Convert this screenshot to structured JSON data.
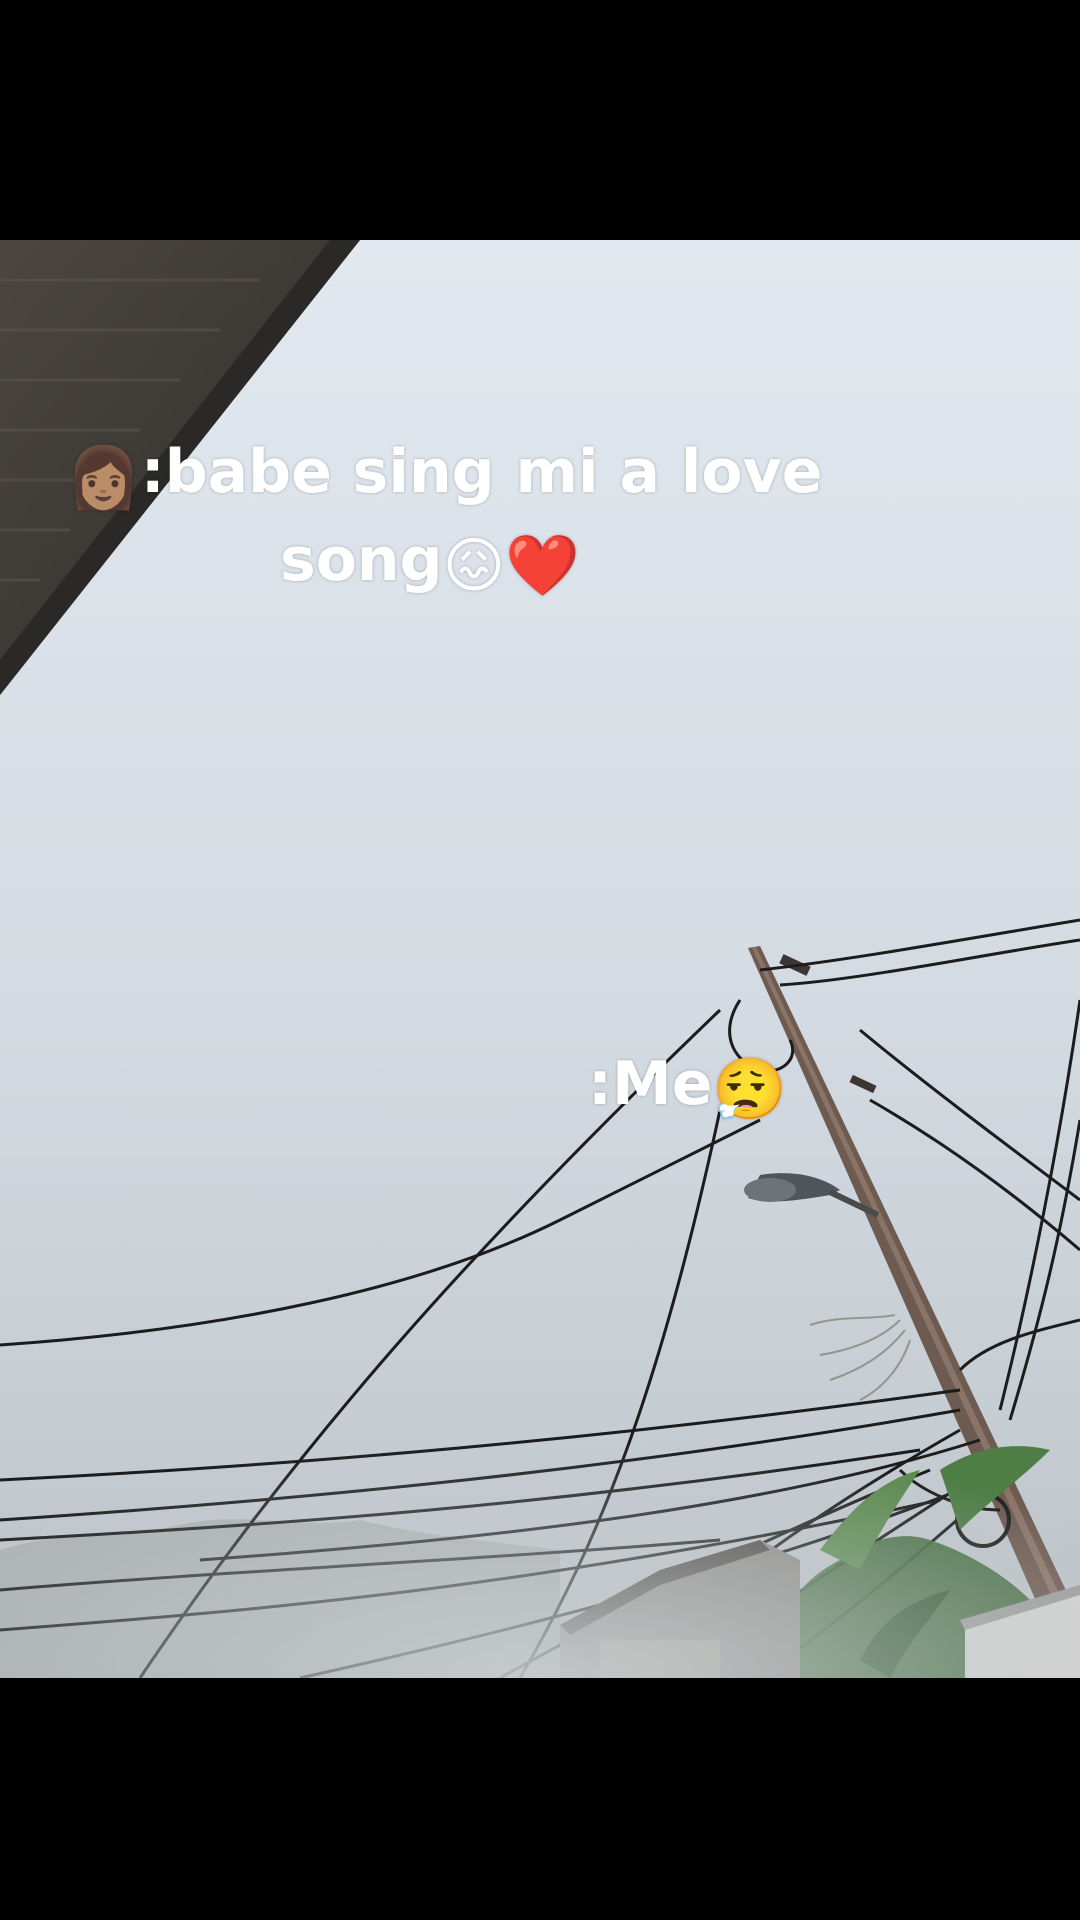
{
  "captions": {
    "line1_prefix_emoji": "👩🏽",
    "line1_text": ":babe sing mi a love",
    "line2_text": "song",
    "line2_emoji_1": "😖",
    "line2_emoji_2": "❤️",
    "me_text": ":Me",
    "me_emoji": "😮‍💨"
  },
  "colors": {
    "caption": "#ffffff",
    "sky_top": "#dfe6ee",
    "sky_bottom": "#c9d1d8",
    "letterbox": "#000000",
    "roof": "#3c3a36"
  }
}
